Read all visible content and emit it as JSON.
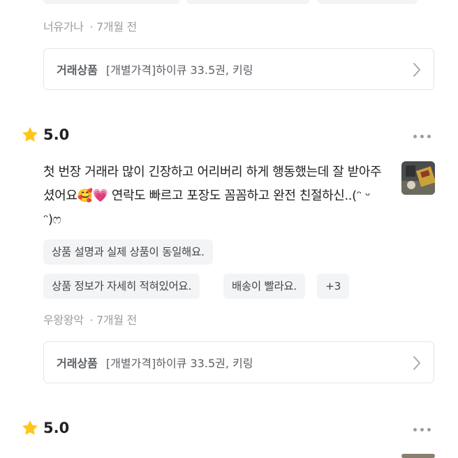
{
  "reviews": [
    {
      "author": "너유가나",
      "time": "· 7개월 전",
      "product_label": "거래상품",
      "product_name": "[개별가격]하이큐 33.5권, 키링"
    },
    {
      "rating": "5.0",
      "rating_value": 5.0,
      "text": "첫 번장 거래라 많이 긴장하고 어리버리 하게 행동했는데 잘 받아주셨어요🥰💗 연락도 빠르고 포장도 꼼꼼하고 완전 친절하신..(ᵔ ᵕ ᵔ)ෆ",
      "tags": [
        "상품 설명과 실제 상품이 동일해요.",
        "상품 정보가 자세히 적혀있어요.",
        "배송이 빨라요.",
        "+3"
      ],
      "author": "우왕왕악",
      "time": "· 7개월 전",
      "product_label": "거래상품",
      "product_name": "[개별가격]하이큐 33.5권, 키링"
    },
    {
      "rating": "5.0",
      "rating_value": 5.0
    }
  ],
  "colors": {
    "star": "#FFC61A",
    "muted": "#9a9da3",
    "tag_bg": "#f3f4f6",
    "border": "#e3e4e7"
  },
  "icons": {
    "star": "star-icon",
    "more": "more-dots-icon",
    "chevron": "chevron-right-icon"
  }
}
